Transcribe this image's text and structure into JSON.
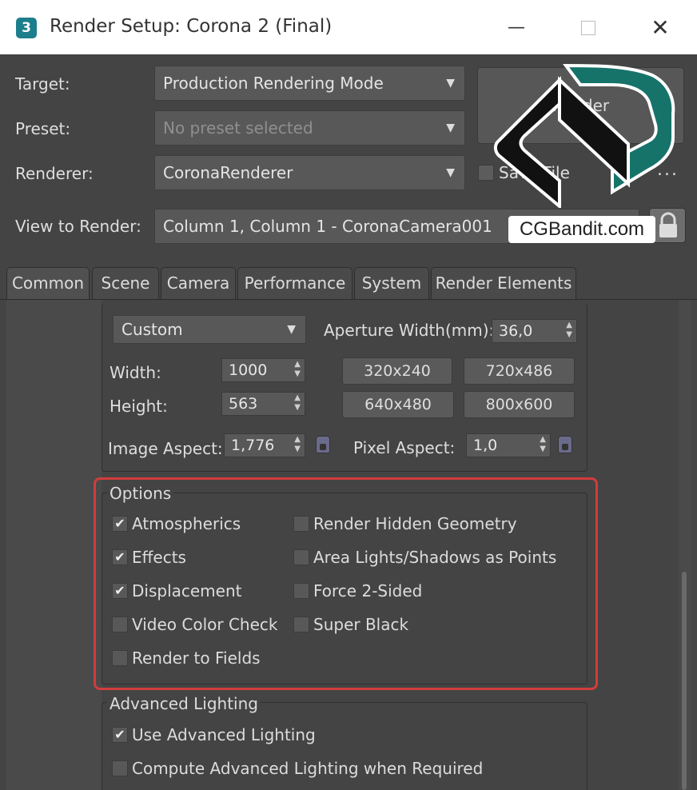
{
  "window": {
    "title": "Render Setup: Corona 2 (Final)",
    "app_icon": "3",
    "minimize_glyph": "—",
    "close_glyph": "✕"
  },
  "top": {
    "target_label": "Target:",
    "target_value": "Production Rendering Mode",
    "preset_label": "Preset:",
    "preset_value": "No preset selected",
    "renderer_label": "Renderer:",
    "renderer_value": "CoronaRenderer",
    "view_label": "View to Render:",
    "view_value": "Column 1, Column 1 - CoronaCamera001",
    "render_button": "Render",
    "save_file_label": "Save File",
    "more_glyph": "...",
    "caret_glyph": "▼"
  },
  "tabs": [
    "Common",
    "Scene",
    "Camera",
    "Performance",
    "System",
    "Render Elements"
  ],
  "output_size": {
    "preset_value": "Custom",
    "aperture_label": "Aperture Width(mm):",
    "aperture_value": "36,0",
    "width_label": "Width:",
    "width_value": "1000",
    "height_label": "Height:",
    "height_value": "563",
    "image_aspect_label": "Image Aspect:",
    "image_aspect_value": "1,776",
    "pixel_aspect_label": "Pixel Aspect:",
    "pixel_aspect_value": "1,0",
    "presets": [
      "320x240",
      "720x486",
      "640x480",
      "800x600"
    ]
  },
  "options": {
    "title": "Options",
    "left": [
      {
        "label": "Atmospherics",
        "checked": true
      },
      {
        "label": "Effects",
        "checked": true
      },
      {
        "label": "Displacement",
        "checked": true
      },
      {
        "label": "Video Color Check",
        "checked": false
      },
      {
        "label": "Render to Fields",
        "checked": false
      }
    ],
    "right": [
      {
        "label": "Render Hidden Geometry",
        "checked": false
      },
      {
        "label": "Area Lights/Shadows as Points",
        "checked": false
      },
      {
        "label": "Force 2-Sided",
        "checked": false
      },
      {
        "label": "Super Black",
        "checked": false
      }
    ]
  },
  "advanced_lighting": {
    "title": "Advanced Lighting",
    "items": [
      {
        "label": "Use Advanced Lighting",
        "checked": true
      },
      {
        "label": "Compute Advanced Lighting when Required",
        "checked": false
      }
    ]
  },
  "watermark": {
    "text": "CGBandit.com",
    "colors": {
      "teal": "#16736a",
      "black": "#111111"
    }
  },
  "check_glyph": "✔",
  "spinner_glyph": "▲▼",
  "colors": {
    "highlight": "#d23c3c",
    "panel": "#444444"
  }
}
